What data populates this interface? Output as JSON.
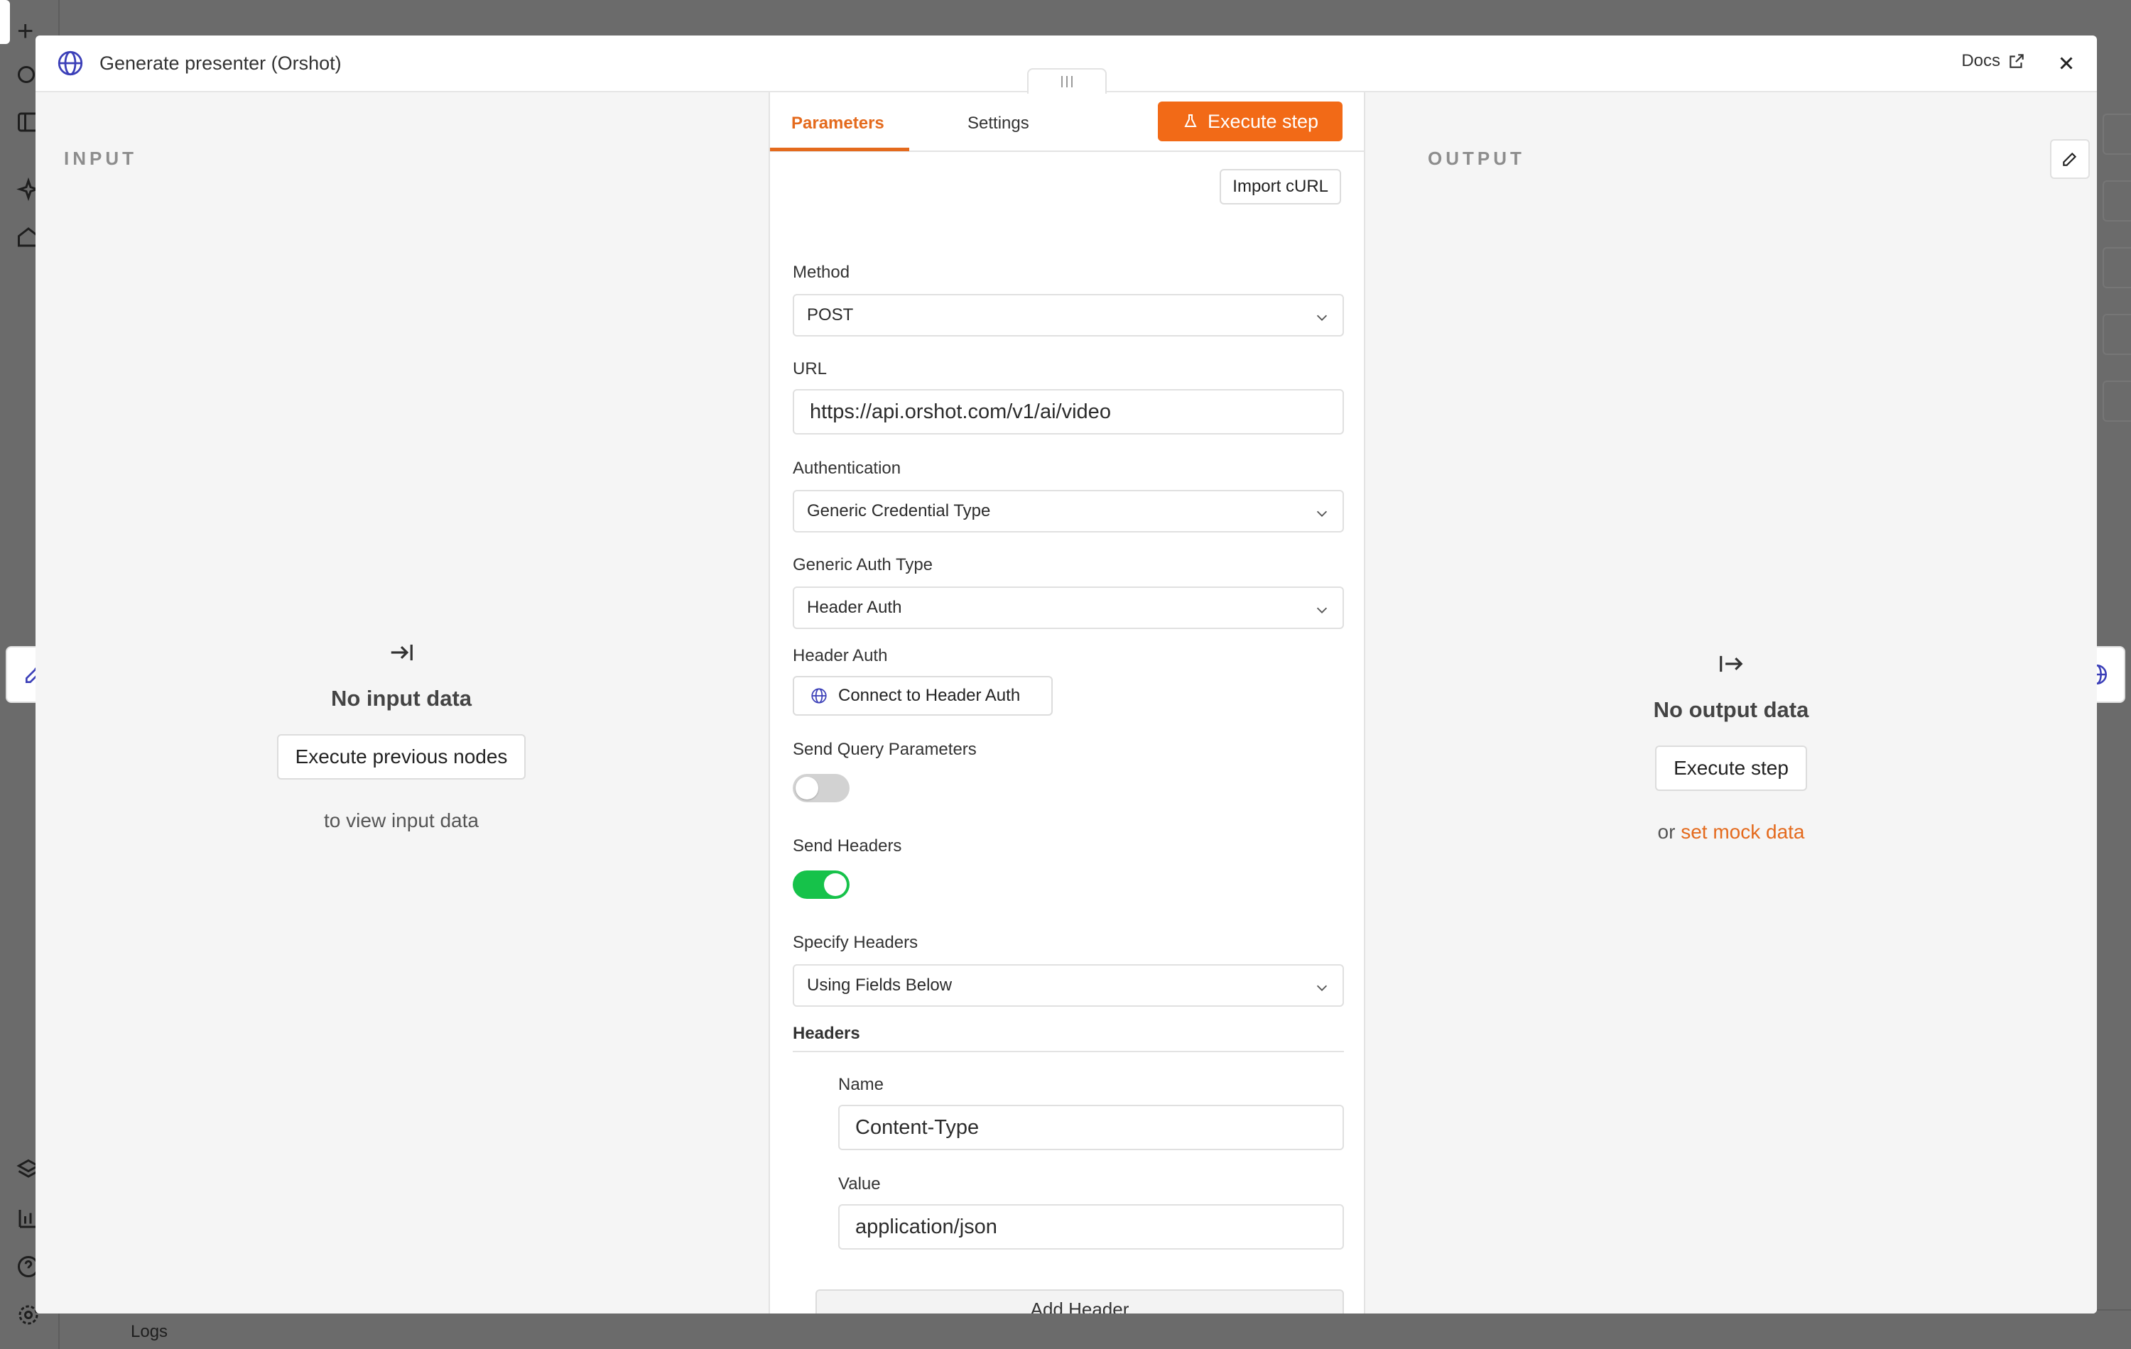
{
  "modal": {
    "title": "Generate presenter (Orshot)",
    "docs_label": "Docs"
  },
  "input_panel": {
    "label": "INPUT",
    "empty_title": "No input data",
    "button_label": "Execute previous nodes",
    "subtext": "to view input data"
  },
  "output_panel": {
    "label": "OUTPUT",
    "empty_title": "No output data",
    "button_label": "Execute step",
    "subtext_prefix": "or",
    "subtext_link": "set mock data"
  },
  "params": {
    "tabs": [
      {
        "label": "Parameters",
        "active": true
      },
      {
        "label": "Settings",
        "active": false
      }
    ],
    "execute_label": "Execute step",
    "import_curl_label": "Import cURL",
    "method": {
      "label": "Method",
      "value": "POST"
    },
    "url": {
      "label": "URL",
      "value": "https://api.orshot.com/v1/ai/video"
    },
    "authentication": {
      "label": "Authentication",
      "value": "Generic Credential Type"
    },
    "generic_auth_type": {
      "label": "Generic Auth Type",
      "value": "Header Auth"
    },
    "header_auth": {
      "label": "Header Auth",
      "button_label": "Connect to Header Auth"
    },
    "send_query": {
      "label": "Send Query Parameters",
      "enabled": false
    },
    "send_headers": {
      "label": "Send Headers",
      "enabled": true
    },
    "specify_headers": {
      "label": "Specify Headers",
      "value": "Using Fields Below"
    },
    "headers": {
      "section_label": "Headers",
      "name_label": "Name",
      "name_value": "Content-Type",
      "value_label": "Value",
      "value_value": "application/json",
      "add_label": "Add Header"
    }
  },
  "background": {
    "logs_label": "Logs"
  },
  "colors": {
    "accent": "#e46a1d",
    "execute_button": "#f26a17",
    "toggle_on": "#16c24a",
    "globe_icon": "#3b3fb8"
  }
}
